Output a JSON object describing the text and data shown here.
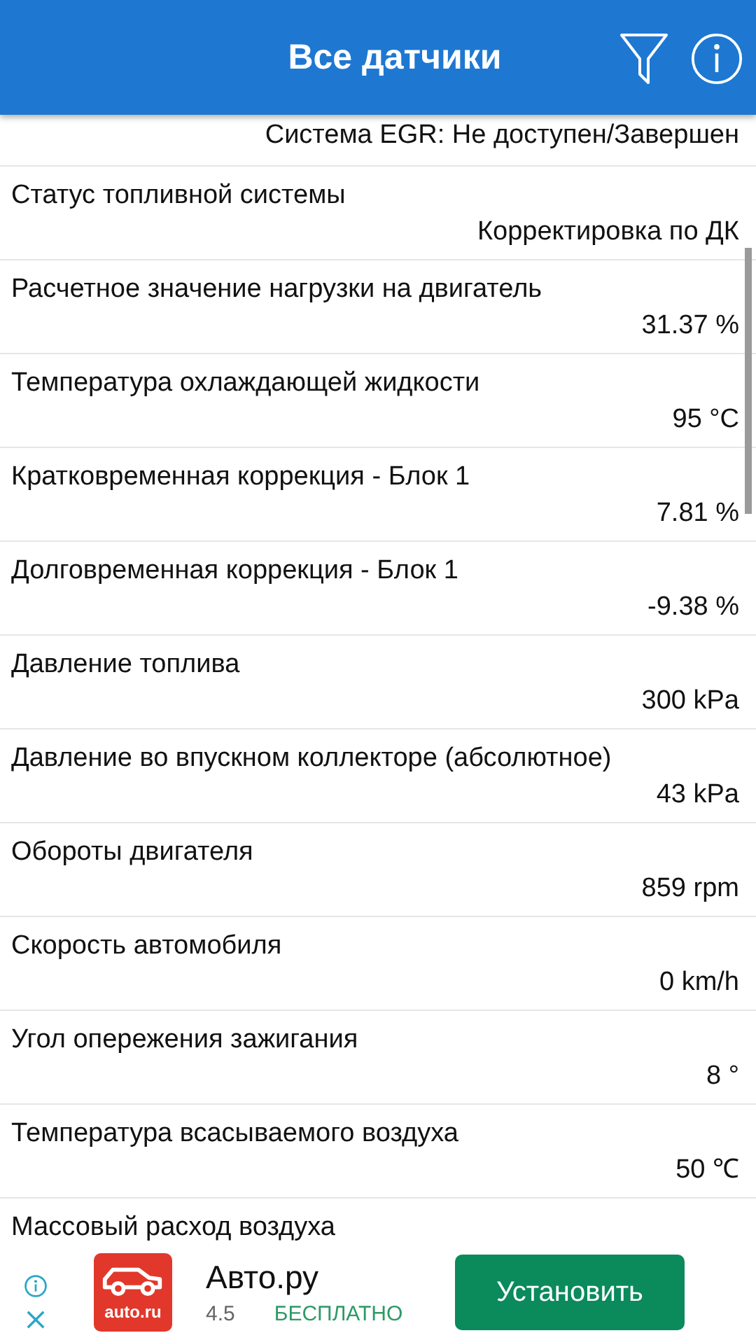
{
  "title": "Все датчики",
  "sensors": [
    {
      "value": "Система EGR: Не доступен/Завершен"
    },
    {
      "name": "Статус топливной системы",
      "value": "Корректировка по ДК"
    },
    {
      "name": "Расчетное значение нагрузки на двигатель",
      "value": "31.37 %"
    },
    {
      "name": "Температура охлаждающей жидкости",
      "value": "95 °C"
    },
    {
      "name": "Кратковременная коррекция - Блок 1",
      "value": "7.81 %"
    },
    {
      "name": "Долговременная коррекция - Блок 1",
      "value": "-9.38 %"
    },
    {
      "name": "Давление топлива",
      "value": "300 kPa"
    },
    {
      "name": "Давление во впускном коллекторе (абсолютное)",
      "value": "43 kPa"
    },
    {
      "name": "Обороты двигателя",
      "value": "859 rpm"
    },
    {
      "name": "Скорость автомобиля",
      "value": "0 km/h"
    },
    {
      "name": "Угол опережения зажигания",
      "value": "8 °"
    },
    {
      "name": "Температура всасываемого воздуха",
      "value": "50 ℃"
    },
    {
      "name": "Массовый расход воздуха"
    }
  ],
  "ad": {
    "logo_text": "auto.ru",
    "app_name": "Авто.ру",
    "rating": "4.5",
    "price": "БЕСПЛАТНО",
    "install_button": "Установить"
  }
}
